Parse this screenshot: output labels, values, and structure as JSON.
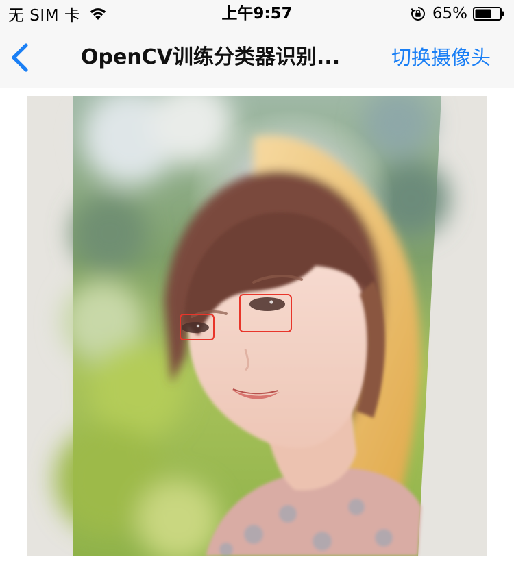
{
  "status_bar": {
    "carrier": "无 SIM 卡",
    "time": "上午9:57",
    "battery_percent": "65%",
    "battery_level": 0.65,
    "icons": [
      "wifi-icon",
      "orientation-lock-icon",
      "battery-icon"
    ]
  },
  "nav": {
    "back_icon": "chevron-left-icon",
    "title": "OpenCV训练分类器识别...",
    "right_button": "切换摄像头",
    "accent_color": "#1a7ff5"
  },
  "preview": {
    "description_icon": "camera-preview",
    "detection_box_color": "#e8352a",
    "detections": [
      {
        "label": "eye"
      },
      {
        "label": "eye"
      }
    ]
  }
}
